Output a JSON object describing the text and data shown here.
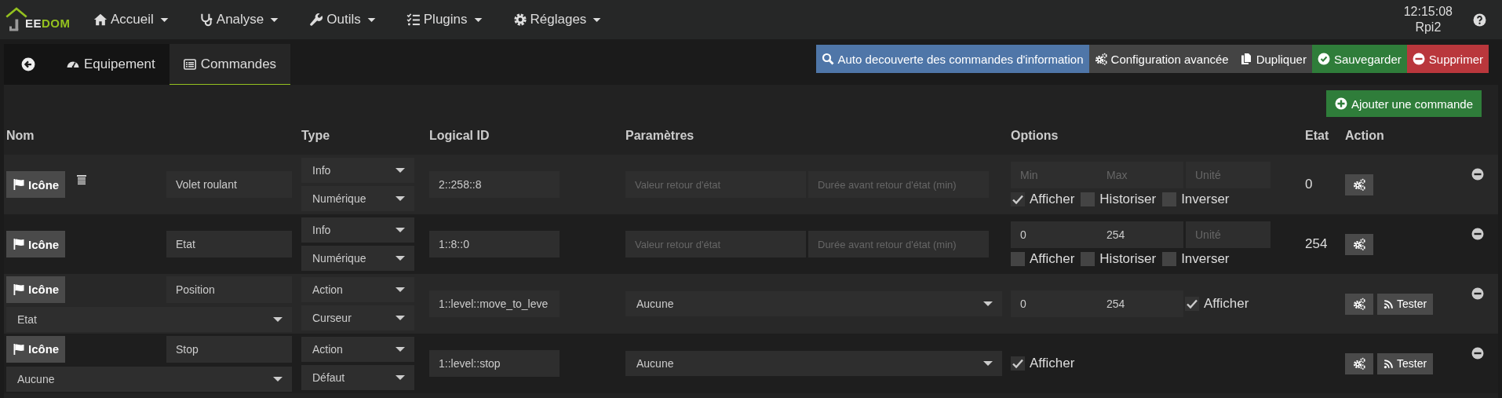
{
  "navbar": {
    "logo": {
      "prefix": "EE",
      "suffix": "DOM"
    },
    "menu": [
      {
        "label": "Accueil"
      },
      {
        "label": "Analyse"
      },
      {
        "label": "Outils"
      },
      {
        "label": "Plugins"
      },
      {
        "label": "Réglages"
      }
    ],
    "clock": {
      "time": "12:15:08",
      "host": "Rpi2"
    }
  },
  "tabs": [
    {
      "label": "Equipement",
      "selected": false
    },
    {
      "label": "Commandes",
      "selected": true
    }
  ],
  "toolbar": [
    {
      "label": "Auto decouverte des commandes d'information",
      "kind": "primary"
    },
    {
      "label": "Configuration avancée",
      "kind": "default"
    },
    {
      "label": "Dupliquer",
      "kind": "default"
    },
    {
      "label": "Sauvegarder",
      "kind": "success"
    },
    {
      "label": "Supprimer",
      "kind": "danger"
    }
  ],
  "add_button": {
    "label": "Ajouter une commande"
  },
  "columns": [
    "Nom",
    "Type",
    "Logical ID",
    "Paramètres",
    "Options",
    "Etat",
    "Action"
  ],
  "commands": [
    {
      "kind": "info",
      "icon_label": "Icône",
      "custom_icon": true,
      "name": "Volet roulant",
      "type": "Info",
      "subtype": "Numérique",
      "logical_id": "2::258::8",
      "parameters": [
        {
          "placeholder": "Valeur retour d'état"
        },
        {
          "placeholder": "Durée avant retour d'état (min)"
        }
      ],
      "min": {
        "placeholder": "Min"
      },
      "max": {
        "placeholder": "Max"
      },
      "unit": {
        "placeholder": "Unité"
      },
      "options": [
        {
          "label": "Afficher",
          "checked": true
        },
        {
          "label": "Historiser",
          "checked": false
        },
        {
          "label": "Inverser",
          "checked": false
        }
      ],
      "state": "0"
    },
    {
      "kind": "info",
      "icon_label": "Icône",
      "custom_icon": false,
      "name": "Etat",
      "type": "Info",
      "subtype": "Numérique",
      "logical_id": "1::8::0",
      "parameters": [
        {
          "placeholder": "Valeur retour d'état"
        },
        {
          "placeholder": "Durée avant retour d'état (min)"
        }
      ],
      "min": {
        "value": "0"
      },
      "max": {
        "value": "254"
      },
      "unit": {
        "placeholder": "Unité"
      },
      "options": [
        {
          "label": "Afficher",
          "checked": false
        },
        {
          "label": "Historiser",
          "checked": false
        },
        {
          "label": "Inverser",
          "checked": false
        }
      ],
      "state": "254"
    },
    {
      "kind": "action",
      "icon_label": "Icône",
      "custom_icon": false,
      "name": "Position",
      "value_link": "Etat",
      "type": "Action",
      "subtype": "Curseur",
      "logical_id": "1::level::move_to_leve",
      "parameter": "Aucune",
      "min": {
        "value": "0"
      },
      "max": {
        "value": "254"
      },
      "options": [
        {
          "label": "Afficher",
          "checked": true
        }
      ],
      "test_label": "Tester"
    },
    {
      "kind": "action",
      "icon_label": "Icône",
      "custom_icon": false,
      "name": "Stop",
      "value_link": "Aucune",
      "type": "Action",
      "subtype": "Défaut",
      "logical_id": "1::level::stop",
      "parameter": "Aucune",
      "options": [
        {
          "label": "Afficher",
          "checked": true
        }
      ],
      "test_label": "Tester"
    }
  ]
}
